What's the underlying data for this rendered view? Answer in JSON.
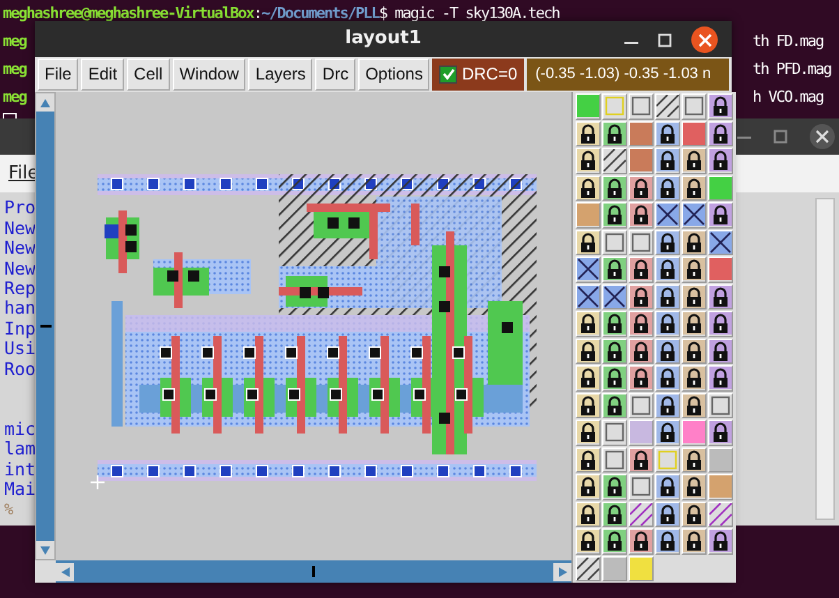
{
  "terminal": {
    "prompt_line": [
      {
        "kind": "user",
        "text": "meghashree@meghashree-VirtualBox"
      },
      {
        "kind": "plain",
        "text": ":"
      },
      {
        "kind": "path",
        "text": "~/Documents/PLL"
      },
      {
        "kind": "plain",
        "text": "$ magic -T sky130A.tech"
      }
    ],
    "left_fragments": [
      "meg",
      "meg",
      "meg"
    ],
    "right_fragments": [
      "th FD.mag",
      "th PFD.mag",
      "h VCO.mag"
    ]
  },
  "background_window": {
    "menu": "File",
    "items_top": [
      "Pro",
      "New",
      "New",
      "New",
      "Rep",
      "han",
      "Inp",
      "Usi",
      "Roo"
    ],
    "items_bottom": [
      "mic",
      "lam",
      "int",
      "Mai"
    ],
    "prompt": "%"
  },
  "window": {
    "title": "layout1",
    "menu": [
      "File",
      "Edit",
      "Cell",
      "Window",
      "Layers",
      "Drc",
      "Options"
    ],
    "drc": {
      "label": "DRC=0",
      "checked": true
    },
    "coordinates": "(-0.35 -1.03) -0.35 -1.03 n"
  }
}
